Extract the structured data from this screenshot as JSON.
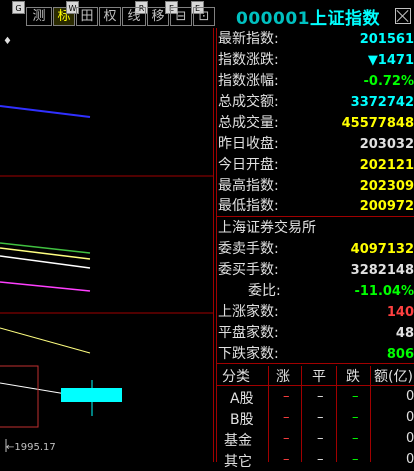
{
  "toolbar": {
    "buttons": [
      {
        "label": "测",
        "hotkey": "G"
      },
      {
        "label": "标",
        "hotkey": "W"
      },
      {
        "label": "田",
        "hotkey": ""
      },
      {
        "label": "权",
        "hotkey": "R"
      },
      {
        "label": "线",
        "hotkey": ""
      },
      {
        "label": "移",
        "hotkey": "E"
      },
      {
        "label": "⊟",
        "hotkey": "E"
      },
      {
        "label": "⊡",
        "hotkey": ""
      }
    ]
  },
  "title": {
    "code": "000001",
    "name": "上证指数"
  },
  "chart": {
    "date_label": "←1995.17",
    "marker": "♦"
  },
  "quote": {
    "rows": [
      {
        "label": "最新指数:",
        "value": "201561",
        "color": "cyan"
      },
      {
        "label": "指数涨跌:",
        "value": "▼1471",
        "color": "cyan"
      },
      {
        "label": "指数涨幅:",
        "value": "-0.72%",
        "color": "green"
      },
      {
        "label": "总成交额:",
        "value": "3372742",
        "color": "cyan"
      },
      {
        "label": "总成交量:",
        "value": "45577848",
        "color": "yellow"
      },
      {
        "label": "昨日收盘:",
        "value": "203032",
        "color": "white"
      },
      {
        "label": "今日开盘:",
        "value": "202121",
        "color": "yellow"
      },
      {
        "label": "最高指数:",
        "value": "202309",
        "color": "yellow"
      },
      {
        "label": "最低指数:",
        "value": "200972",
        "color": "yellow"
      }
    ]
  },
  "exchange": {
    "name": "上海证券交易所",
    "rows": [
      {
        "label": "委卖手数:",
        "value": "4097132",
        "color": "yellow"
      },
      {
        "label": "委买手数:",
        "value": "3282148",
        "color": "white"
      },
      {
        "label": "委比:",
        "value": "-11.04%",
        "color": "green"
      },
      {
        "label": "上涨家数:",
        "value": "140",
        "color": "red"
      },
      {
        "label": "平盘家数:",
        "value": "48",
        "color": "white"
      },
      {
        "label": "下跌家数:",
        "value": "806",
        "color": "green"
      }
    ]
  },
  "table": {
    "headers": [
      "分类",
      "涨",
      "平",
      "跌",
      "额(亿)"
    ],
    "rows": [
      {
        "name": "A股",
        "up": "–",
        "flat": "–",
        "down": "–",
        "amount": "0"
      },
      {
        "name": "B股",
        "up": "–",
        "flat": "–",
        "down": "–",
        "amount": "0"
      },
      {
        "name": "基金",
        "up": "–",
        "flat": "–",
        "down": "–",
        "amount": "0"
      },
      {
        "name": "其它",
        "up": "–",
        "flat": "–",
        "down": "–",
        "amount": "0"
      }
    ]
  }
}
